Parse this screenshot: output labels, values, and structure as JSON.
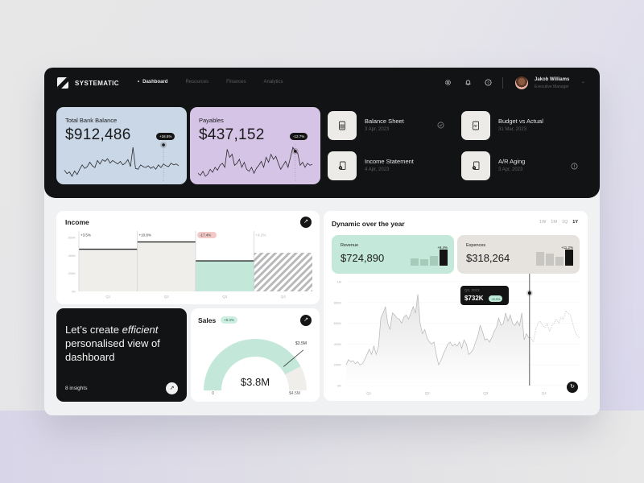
{
  "app": {
    "brand": "SYSTEMATIC",
    "nav": [
      {
        "label": "Dashboard",
        "active": true
      },
      {
        "label": "Resources",
        "active": false
      },
      {
        "label": "Finances",
        "active": false
      },
      {
        "label": "Analytics",
        "active": false
      }
    ],
    "header_icons": [
      "gear-icon",
      "bell-icon",
      "help-icon"
    ],
    "user": {
      "name": "Jakob Williams",
      "role": "Executive Manager"
    }
  },
  "stats": [
    {
      "label": "Total Bank Balance",
      "value": "$912,486",
      "delta": "+16.5%",
      "color": "#c9d7e6",
      "spark": [
        18,
        14,
        16,
        11,
        17,
        13,
        19,
        24,
        20,
        22,
        27,
        23,
        21,
        29,
        25,
        30,
        28,
        31,
        26,
        29,
        27,
        25,
        28,
        24,
        26,
        30,
        22,
        44,
        20,
        19,
        24,
        22,
        21,
        23,
        20,
        22,
        19,
        24,
        21,
        25,
        23,
        22,
        26,
        24,
        25,
        23
      ]
    },
    {
      "label": "Payables",
      "value": "$437,152",
      "delta": "-12.7%",
      "color": "#d6c4e6",
      "spark": [
        14,
        12,
        16,
        11,
        13,
        18,
        15,
        20,
        17,
        22,
        24,
        20,
        38,
        30,
        33,
        22,
        24,
        28,
        20,
        25,
        18,
        16,
        20,
        14,
        19,
        22,
        26,
        20,
        30,
        25,
        33,
        28,
        31,
        24,
        18,
        22,
        26,
        20,
        30,
        40,
        36,
        34,
        22,
        25,
        20,
        24,
        22,
        23
      ]
    }
  ],
  "reports": [
    {
      "title": "Balance Sheet",
      "date": "3 Apr, 2023",
      "status": "check-circle-icon",
      "icon": "document-icon"
    },
    {
      "title": "Budget vs Actual",
      "date": "31 Mar, 2023",
      "status": "",
      "icon": "document-chart-icon"
    },
    {
      "title": "Income Statement",
      "date": "4 Apr, 2023",
      "status": "",
      "icon": "document-gear-icon"
    },
    {
      "title": "A/R Aging",
      "date": "3 Apr, 2023",
      "status": "info-icon",
      "icon": "document-clock-icon"
    }
  ],
  "income": {
    "title": "Income",
    "chart_data": {
      "type": "bar",
      "categories": [
        "Q1",
        "Q2",
        "Q3",
        "Q4"
      ],
      "values": [
        470,
        550,
        340,
        430
      ],
      "deltas": [
        "+3.5%",
        "+10.8%",
        "-17.4%",
        "+4.2%"
      ],
      "ylim": [
        0,
        600
      ],
      "yticks": [
        "0K",
        "200K",
        "400K",
        "600K"
      ],
      "highlight": "Q3",
      "projected": "Q4"
    }
  },
  "promo": {
    "line1": "Let’s create ",
    "emph": "efficient",
    "line2": "personalised view of dashboard",
    "insights": "8 insights"
  },
  "sales": {
    "title": "Sales",
    "delta": "+8.3%",
    "value": "$3.8M",
    "chart_data": {
      "type": "gauge",
      "min": 0,
      "max": 4.5,
      "value": 3.8,
      "target": 3.5,
      "labels": {
        "min": "0",
        "max": "$4.5M",
        "target": "$3.5M"
      }
    }
  },
  "dynamic": {
    "title": "Dynamic over the year",
    "ranges": [
      {
        "label": "1W",
        "active": false
      },
      {
        "label": "1M",
        "active": false
      },
      {
        "label": "1Q",
        "active": false
      },
      {
        "label": "1Y",
        "active": true
      }
    ],
    "revenue": {
      "label": "Revenue",
      "value": "$724,890",
      "delta": "+8.4%",
      "bars": [
        0.45,
        0.4,
        0.6,
        1.0
      ]
    },
    "expenses": {
      "label": "Expences",
      "value": "$318,264",
      "delta": "+11.2%",
      "bars": [
        0.85,
        0.75,
        0.55,
        1.0
      ]
    },
    "tooltip": {
      "period": "Q3, 2023",
      "value": "$732K",
      "delta": "+8.3%"
    },
    "chart_data": {
      "type": "line",
      "title": "Dynamic over the year",
      "xticks": [
        "Q1",
        "Q2",
        "Q3",
        "Q4"
      ],
      "yticks": [
        "0K",
        "200K",
        "400K",
        "600K",
        "800K",
        "1M"
      ],
      "ylim": [
        0,
        1000
      ],
      "actual": [
        200,
        250,
        230,
        240,
        210,
        230,
        200,
        210,
        250,
        300,
        350,
        300,
        380,
        300,
        380,
        650,
        700,
        760,
        600,
        540,
        700,
        680,
        650,
        640,
        600,
        660,
        680,
        640,
        700,
        760,
        700,
        880,
        600,
        500,
        540,
        460,
        420,
        400,
        420,
        300,
        200,
        240,
        300,
        350,
        400,
        420,
        380,
        400,
        380,
        420,
        360,
        440,
        400,
        300,
        320,
        350,
        420,
        480,
        580,
        520,
        440,
        450,
        420,
        460,
        520,
        560,
        650,
        580,
        600,
        700,
        620,
        680,
        600,
        580,
        620,
        580,
        700,
        440,
        500,
        460
      ],
      "projected": [
        460,
        420,
        540,
        600,
        620,
        580,
        560,
        600,
        520,
        580,
        600,
        640,
        600,
        660,
        640,
        720,
        700,
        680,
        600,
        520,
        480,
        460
      ]
    }
  }
}
